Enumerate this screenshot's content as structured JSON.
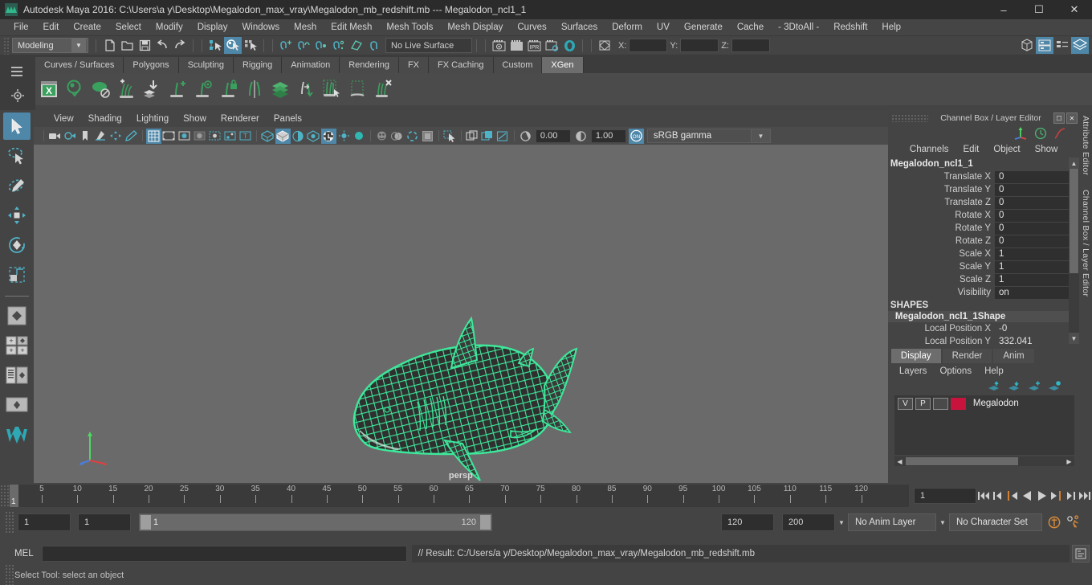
{
  "window": {
    "title": "Autodesk Maya 2016: C:\\Users\\a y\\Desktop\\Megalodon_max_vray\\Megalodon_mb_redshift.mb   ---   Megalodon_ncl1_1",
    "minimize": "–",
    "maximize": "☐",
    "close": "✕"
  },
  "menubar": {
    "items": [
      {
        "label": "File"
      },
      {
        "label": "Edit"
      },
      {
        "label": "Create"
      },
      {
        "label": "Select"
      },
      {
        "label": "Modify"
      },
      {
        "label": "Display"
      },
      {
        "label": "Windows"
      },
      {
        "label": "Mesh"
      },
      {
        "label": "Edit Mesh"
      },
      {
        "label": "Mesh Tools"
      },
      {
        "label": "Mesh Display"
      },
      {
        "label": "Curves"
      },
      {
        "label": "Surfaces"
      },
      {
        "label": "Deform"
      },
      {
        "label": "UV"
      },
      {
        "label": "Generate"
      },
      {
        "label": "Cache"
      },
      {
        "label": "- 3DtoAll -"
      },
      {
        "label": "Redshift"
      },
      {
        "label": "Help"
      }
    ]
  },
  "statusline": {
    "menu_set": "Modeling",
    "live_surface": "No Live Surface",
    "coord_x_label": "X:",
    "coord_y_label": "Y:",
    "coord_z_label": "Z:",
    "coord_x_value": "",
    "coord_y_value": "",
    "coord_z_value": ""
  },
  "shelf": {
    "tabs": [
      {
        "label": "Curves / Surfaces",
        "active": false
      },
      {
        "label": "Polygons",
        "active": false
      },
      {
        "label": "Sculpting",
        "active": false
      },
      {
        "label": "Rigging",
        "active": false
      },
      {
        "label": "Animation",
        "active": false
      },
      {
        "label": "Rendering",
        "active": false
      },
      {
        "label": "FX",
        "active": false
      },
      {
        "label": "FX Caching",
        "active": false
      },
      {
        "label": "Custom",
        "active": false
      },
      {
        "label": "XGen",
        "active": true
      }
    ],
    "icons": [
      "xgen-editor-icon",
      "xgen-preview-icon",
      "xgen-disable-preview-icon",
      "xgen-add-description-icon",
      "xgen-import-collection-icon",
      "xgen-add-guide-icon",
      "xgen-guide-visibility-icon",
      "xgen-lock-guide-icon",
      "xgen-mirror-guide-icon",
      "xgen-layers-icon",
      "xgen-transfer-icon",
      "xgen-select-guides-icon",
      "xgen-region-icon",
      "xgen-delete-guide-icon"
    ]
  },
  "toolbox": {
    "tools": [
      {
        "name": "select-tool",
        "active": true
      },
      {
        "name": "lasso-select-tool",
        "active": false
      },
      {
        "name": "paint-select-tool",
        "active": false
      },
      {
        "name": "move-tool",
        "active": false
      },
      {
        "name": "rotate-tool",
        "active": false
      },
      {
        "name": "scale-tool",
        "active": false
      },
      {
        "name": "last-tool-used",
        "active": false
      },
      {
        "name": "four-view-layout",
        "active": false
      },
      {
        "name": "outliner-persp-layout",
        "active": false
      },
      {
        "name": "persp-only-layout",
        "active": false
      },
      {
        "name": "maya-logo",
        "active": false
      }
    ]
  },
  "viewport": {
    "menu": [
      {
        "label": "View"
      },
      {
        "label": "Shading"
      },
      {
        "label": "Lighting"
      },
      {
        "label": "Show"
      },
      {
        "label": "Renderer"
      },
      {
        "label": "Panels"
      }
    ],
    "exposure_value": "0.00",
    "gamma_value": "1.00",
    "color_profile": "sRGB gamma",
    "camera_label": "persp",
    "mesh_color": "#3ee89b",
    "background_color": "#6a6a6a"
  },
  "channelbox": {
    "panel_title": "Channel Box / Layer Editor",
    "menu": [
      {
        "label": "Channels"
      },
      {
        "label": "Edit"
      },
      {
        "label": "Object"
      },
      {
        "label": "Show"
      }
    ],
    "object_name": "Megalodon_ncl1_1",
    "channels": [
      {
        "label": "Translate X",
        "value": "0"
      },
      {
        "label": "Translate Y",
        "value": "0"
      },
      {
        "label": "Translate Z",
        "value": "0"
      },
      {
        "label": "Rotate X",
        "value": "0"
      },
      {
        "label": "Rotate Y",
        "value": "0"
      },
      {
        "label": "Rotate Z",
        "value": "0"
      },
      {
        "label": "Scale X",
        "value": "1"
      },
      {
        "label": "Scale Y",
        "value": "1"
      },
      {
        "label": "Scale Z",
        "value": "1"
      },
      {
        "label": "Visibility",
        "value": "on"
      }
    ],
    "shapes_header": "SHAPES",
    "shape_name": "Megalodon_ncl1_1Shape",
    "shape_channels": [
      {
        "label": "Local Position X",
        "value": "-0"
      },
      {
        "label": "Local Position Y",
        "value": "332.041"
      }
    ]
  },
  "layereditor": {
    "tabs": [
      {
        "label": "Display",
        "active": true
      },
      {
        "label": "Render",
        "active": false
      },
      {
        "label": "Anim",
        "active": false
      }
    ],
    "menu": [
      {
        "label": "Layers"
      },
      {
        "label": "Options"
      },
      {
        "label": "Help"
      }
    ],
    "layers": [
      {
        "visibility": "V",
        "playback": "P",
        "state": "",
        "color": "#c8143c",
        "name": "Megalodon"
      }
    ]
  },
  "attribute_editor_tab": "Attribute Editor",
  "channelbox_side_tab": "Channel Box / Layer Editor",
  "timeline": {
    "start": 1,
    "end": 120,
    "current_frame": "1",
    "tick_step": 5,
    "tick_labels": [
      5,
      10,
      15,
      20,
      25,
      30,
      35,
      40,
      45,
      50,
      55,
      60,
      65,
      70,
      75,
      80,
      85,
      90,
      95,
      100,
      105,
      110,
      115,
      120
    ],
    "current_frame_field": "1",
    "playback_buttons": [
      "go-to-start-icon",
      "step-back-keyframe-icon",
      "step-back-frame-icon",
      "play-backwards-icon",
      "play-forwards-icon",
      "step-forward-frame-icon",
      "step-forward-keyframe-icon",
      "go-to-end-icon"
    ]
  },
  "range_slider": {
    "anim_start": "1",
    "range_start": "1",
    "bar_start": "1",
    "bar_end": "120",
    "range_end": "120",
    "anim_end": "200",
    "anim_layer": "No Anim Layer",
    "character_set": "No Character Set"
  },
  "command_line": {
    "language": "MEL",
    "input_value": "",
    "result": "// Result: C:/Users/a y/Desktop/Megalodon_max_vray/Megalodon_mb_redshift.mb"
  },
  "help_line": {
    "text": "Select Tool: select an object"
  }
}
